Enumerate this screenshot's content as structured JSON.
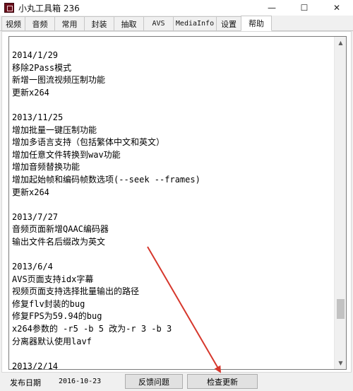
{
  "window": {
    "title": "小丸工具箱 236",
    "minimize_glyph": "—",
    "maximize_glyph": "☐",
    "close_glyph": "✕"
  },
  "tabs": [
    {
      "label": "视频"
    },
    {
      "label": "音频"
    },
    {
      "label": "常用"
    },
    {
      "label": "封装"
    },
    {
      "label": "抽取"
    },
    {
      "label": "AVS"
    },
    {
      "label": "MediaInfo"
    },
    {
      "label": "设置"
    },
    {
      "label": "帮助",
      "active": true
    }
  ],
  "changelog": [
    "2014/1/29",
    "移除2Pass模式",
    "新增一图流视频压制功能",
    "更新x264",
    "",
    "2013/11/25",
    "增加批量一键压制功能",
    "增加多语言支持（包括繁体中文和英文）",
    "增加任意文件转换到wav功能",
    "增加音频替换功能",
    "增加起始帧和编码帧数选项(--seek --frames)",
    "更新x264",
    "",
    "2013/7/27",
    "音频页面新增QAAC编码器",
    "输出文件名后缀改为英文",
    "",
    "2013/6/4",
    "AVS页面支持idx字幕",
    "视频页面支持选择批量输出的路径",
    "修复flv封装的bug",
    "修复FPS为59.94的bug",
    "x264参数的 -r5 -b 5 改为-r 3 -b 3",
    "分离器默认使用lavf",
    "",
    "2013/2/14"
  ],
  "status": {
    "release_label": "发布日期",
    "release_date": "2016-10-23",
    "feedback_button": "反馈问题",
    "update_button": "检查更新"
  },
  "colors": {
    "annotation_arrow": "#d6372c",
    "scrollbar_thumb": "#c2c2c2"
  }
}
